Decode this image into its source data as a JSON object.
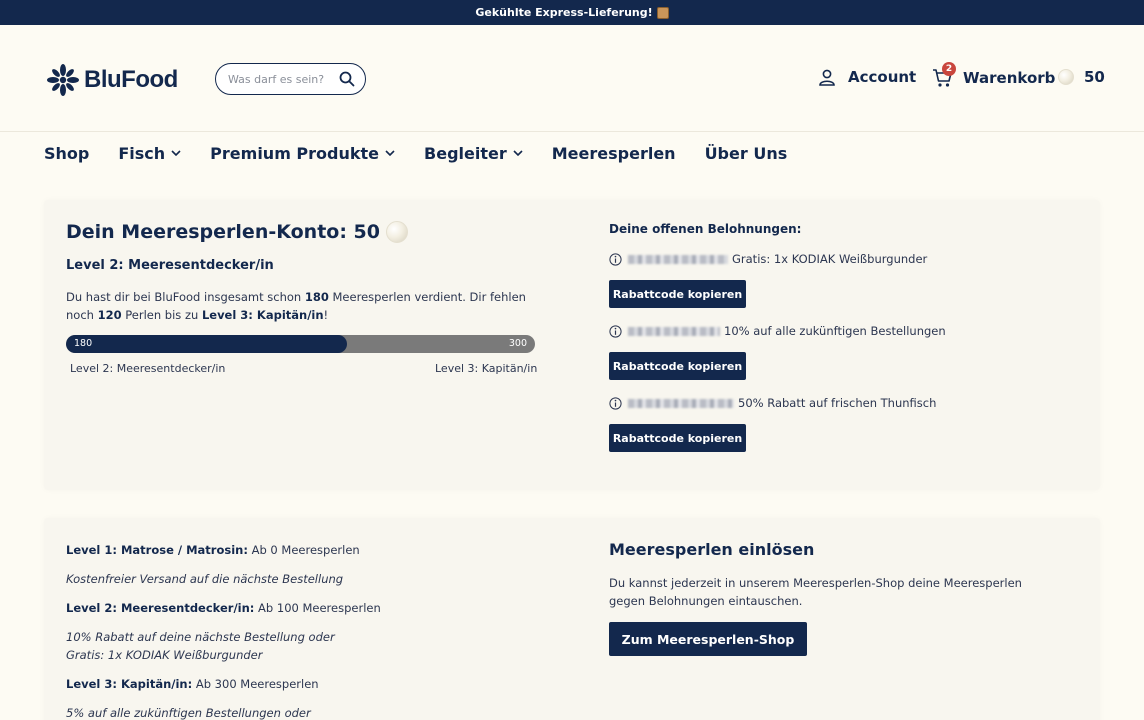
{
  "topbar": {
    "text": "Gekühlte Express-Lieferung!",
    "icon": "package-icon"
  },
  "header": {
    "logo_text": "BluFood",
    "search_placeholder": "Was darf es sein?",
    "account_label": "Account",
    "cart_label": "Warenkorb",
    "cart_count": "2",
    "pearl_points": "50"
  },
  "nav": {
    "items": [
      {
        "label": "Shop",
        "has_dropdown": false
      },
      {
        "label": "Fisch",
        "has_dropdown": true
      },
      {
        "label": "Premium Produkte",
        "has_dropdown": true
      },
      {
        "label": "Begleiter",
        "has_dropdown": true
      },
      {
        "label": "Meeresperlen",
        "has_dropdown": false
      },
      {
        "label": "Über Uns",
        "has_dropdown": false
      }
    ]
  },
  "konto": {
    "title": "Dein Meeresperlen-Konto: 50",
    "level": "Level 2: Meeresentdecker/in",
    "text_part1": "Du hast dir bei BluFood insgesamt schon ",
    "earned": "180",
    "text_part2": " Meeresperlen verdient. Dir fehlen noch ",
    "missing": "120",
    "text_part3": " Perlen bis zu ",
    "next_level": "Level 3: Kapitän/in",
    "text_part4": "!",
    "progress_start": "180",
    "progress_end": "300",
    "progress_fraction": 0.6,
    "label_left": "Level 2: Meeresentdecker/in",
    "label_right": "Level 3: Kapitän/in"
  },
  "rewards": {
    "title": "Deine offenen Belohnungen:",
    "items": [
      {
        "text": "Gratis: 1x KODIAK Weißburgunder",
        "button": "Rabattcode kopieren"
      },
      {
        "text": "10% auf alle zukünftigen Bestellungen",
        "button": "Rabattcode kopieren"
      },
      {
        "text": "50% Rabatt auf frischen Thunfisch",
        "button": "Rabattcode kopieren"
      }
    ]
  },
  "levels": {
    "l1_title": "Level 1: Matrose / Matrosin:",
    "l1_req": " Ab 0 Meeresperlen",
    "l1_reward": "Kostenfreier Versand auf die nächste Bestellung",
    "l2_title": "Level 2: Meeresentdecker/in:",
    "l2_req": " Ab 100 Meeresperlen",
    "l2_reward_1": "10% Rabatt auf deine nächste Bestellung oder",
    "l2_reward_2": "Gratis: 1x KODIAK Weißburgunder",
    "l3_title": "Level 3: Kapitän/in:",
    "l3_req": " Ab 300 Meeresperlen",
    "l3_reward": "5% auf alle zukünftigen Bestellungen oder"
  },
  "redeem": {
    "title": "Meeresperlen einlösen",
    "text": "Du kannst jederzeit in unserem Meeresperlen-Shop deine Meeresperlen gegen Belohnungen eintauschen.",
    "button": "Zum Meeresperlen-Shop"
  },
  "colors": {
    "navy": "#13284d",
    "badge": "#c9463d",
    "background": "#fdfbf3",
    "card": "#f8f6ef",
    "progress_track": "#7a7a7a"
  }
}
